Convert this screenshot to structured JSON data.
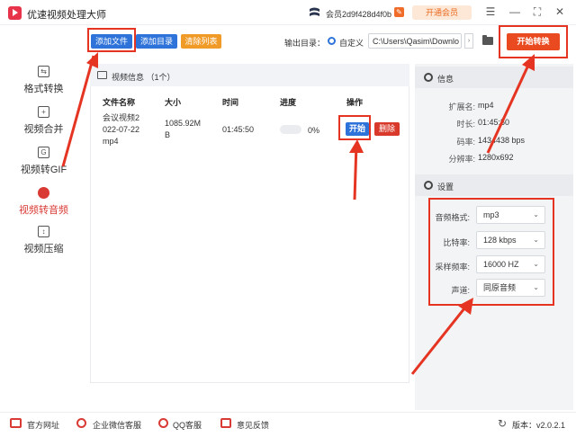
{
  "app": {
    "title": "优速视频处理大师",
    "member": "会员2d9f428d4f0b",
    "vip_label": "开通会员"
  },
  "window_controls": [
    "☰",
    "—",
    "⛶",
    "✕"
  ],
  "sidebar": {
    "items": [
      {
        "label": "格式转换",
        "icon": "format-convert-icon",
        "active": false
      },
      {
        "label": "视频合并",
        "icon": "merge-icon",
        "active": false
      },
      {
        "label": "视频转GIF",
        "icon": "gif-icon",
        "active": false
      },
      {
        "label": "视频转音频",
        "icon": "audio-icon",
        "active": true
      },
      {
        "label": "视频压缩",
        "icon": "compress-icon",
        "active": false
      }
    ]
  },
  "toolbar": {
    "add_file": "添加文件",
    "add_dir": "添加目录",
    "clear_list": "清除列表",
    "output_label": "输出目录：",
    "radio_label": "自定义",
    "output_path": "C:\\Users\\Qasim\\Downlo",
    "start_convert": "开始转换"
  },
  "file_list": {
    "title": "视频信息 （1个）",
    "columns": [
      "文件名称",
      "大小",
      "时间",
      "进度",
      "操作"
    ],
    "rows": [
      {
        "name_lines": [
          "会议视频2",
          "022-07-22",
          "mp4"
        ],
        "size_lines": [
          "1085.92M",
          "B"
        ],
        "time": "01:45:50",
        "progress": "0%",
        "progress_value": 0,
        "start_label": "开始",
        "delete_label": "删除"
      }
    ]
  },
  "info": {
    "title": "信息",
    "fields": [
      {
        "key": "扩展名:",
        "value": "mp4"
      },
      {
        "key": "时长:",
        "value": "01:45:50"
      },
      {
        "key": "码率:",
        "value": "1434438 bps"
      },
      {
        "key": "分辨率:",
        "value": "1280x692"
      }
    ]
  },
  "settings": {
    "title": "设置",
    "fields": [
      {
        "key": "音频格式:",
        "value": "mp3"
      },
      {
        "key": "比特率:",
        "value": "128 kbps"
      },
      {
        "key": "采样频率:",
        "value": "16000 HZ"
      },
      {
        "key": "声道:",
        "value": "同原音频"
      }
    ]
  },
  "footer": {
    "items": [
      "官方网址",
      "企业微信客服",
      "QQ客服",
      "意见反馈"
    ],
    "version": "版本：v2.0.2.1"
  },
  "colors": {
    "accent": "#2e73d9",
    "danger": "#d9392a",
    "orange": "#ea4a1f",
    "annotation": "#e53522"
  }
}
